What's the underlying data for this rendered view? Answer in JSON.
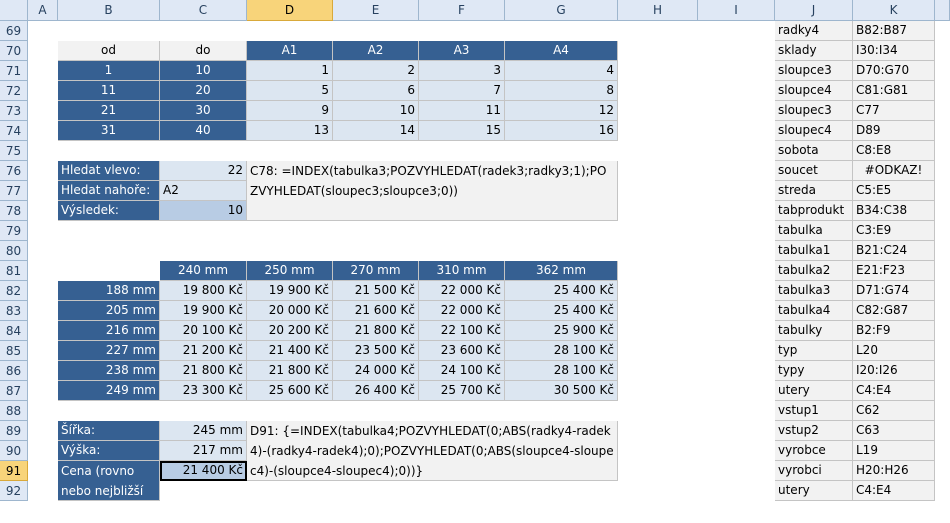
{
  "columns": [
    "A",
    "B",
    "C",
    "D",
    "E",
    "F",
    "G",
    "H",
    "I",
    "J",
    "K"
  ],
  "selected_column": "D",
  "rows": [
    69,
    70,
    71,
    72,
    73,
    74,
    75,
    76,
    77,
    78,
    79,
    80,
    81,
    82,
    83,
    84,
    85,
    86,
    87,
    88,
    89,
    90,
    91,
    92
  ],
  "selected_row": 91,
  "table1": {
    "headers": [
      "od",
      "do",
      "A1",
      "A2",
      "A3",
      "A4"
    ],
    "rows": [
      [
        "1",
        "10",
        "1",
        "2",
        "3",
        "4"
      ],
      [
        "11",
        "20",
        "5",
        "6",
        "7",
        "8"
      ],
      [
        "21",
        "30",
        "9",
        "10",
        "11",
        "12"
      ],
      [
        "31",
        "40",
        "13",
        "14",
        "15",
        "16"
      ]
    ]
  },
  "lookup1": {
    "labels": [
      "Hledat vlevo:",
      "Hledat nahoře:",
      "Výsledek:"
    ],
    "values": [
      "22",
      "A2",
      "10"
    ],
    "formula": "C78: =INDEX(tabulka3;POZVYHLEDAT(radek3;radky3;1);POZVYHLEDAT(sloupec3;sloupce3;0))"
  },
  "table2": {
    "headers": [
      "240 mm",
      "250 mm",
      "270 mm",
      "310 mm",
      "362 mm"
    ],
    "rows": [
      {
        "label": "188 mm",
        "values": [
          "19 800 Kč",
          "19 900 Kč",
          "21 500 Kč",
          "22 000 Kč",
          "25 400 Kč"
        ]
      },
      {
        "label": "205 mm",
        "values": [
          "19 900 Kč",
          "20 000 Kč",
          "21 600 Kč",
          "22 000 Kč",
          "25 400 Kč"
        ]
      },
      {
        "label": "216 mm",
        "values": [
          "20 100 Kč",
          "20 200 Kč",
          "21 800 Kč",
          "22 100 Kč",
          "25 900 Kč"
        ]
      },
      {
        "label": "227 mm",
        "values": [
          "21 200 Kč",
          "21 400 Kč",
          "23 500 Kč",
          "23 600 Kč",
          "28 100 Kč"
        ]
      },
      {
        "label": "238 mm",
        "values": [
          "21 800 Kč",
          "21 800 Kč",
          "24 000 Kč",
          "24 100 Kč",
          "28 100 Kč"
        ]
      },
      {
        "label": "249 mm",
        "values": [
          "23 300 Kč",
          "25 600 Kč",
          "26 400 Kč",
          "25 700 Kč",
          "30 500 Kč"
        ]
      }
    ]
  },
  "lookup2": {
    "labels": [
      "Šířka:",
      "Výška:",
      "Cena (rovno nebo nejbližší vyšší):"
    ],
    "values": [
      "245 mm",
      "217 mm",
      "21 400 Kč"
    ],
    "formula": "D91: {=INDEX(tabulka4;POZVYHLEDAT(0;ABS(radky4-radek4)-(radky4-radek4);0);POZVYHLEDAT(0;ABS(sloupce4-sloupec4)-(sloupce4-sloupec4);0))}"
  },
  "names": [
    [
      "radky4",
      "B82:B87"
    ],
    [
      "sklady",
      "I30:I34"
    ],
    [
      "sloupce3",
      "D70:G70"
    ],
    [
      "sloupce4",
      "C81:G81"
    ],
    [
      "sloupec3",
      "C77"
    ],
    [
      "sloupec4",
      "D89"
    ],
    [
      "sobota",
      "C8:E8"
    ],
    [
      "soucet",
      "#ODKAZ!"
    ],
    [
      "streda",
      "C5:E5"
    ],
    [
      "tabprodukt",
      "B34:C38"
    ],
    [
      "tabulka",
      "C3:E9"
    ],
    [
      "tabulka1",
      "B21:C24"
    ],
    [
      "tabulka2",
      "E21:F23"
    ],
    [
      "tabulka3",
      "D71:G74"
    ],
    [
      "tabulka4",
      "C82:G87"
    ],
    [
      "tabulky",
      "B2:F9"
    ],
    [
      "typ",
      "L20"
    ],
    [
      "typy",
      "I20:I26"
    ],
    [
      "utery",
      "C4:E4"
    ],
    [
      "vstup1",
      "C62"
    ],
    [
      "vstup2",
      "C63"
    ],
    [
      "vyrobce",
      "L19"
    ],
    [
      "vyrobci",
      "H20:H26"
    ],
    [
      "utery",
      "C4:E4"
    ]
  ]
}
